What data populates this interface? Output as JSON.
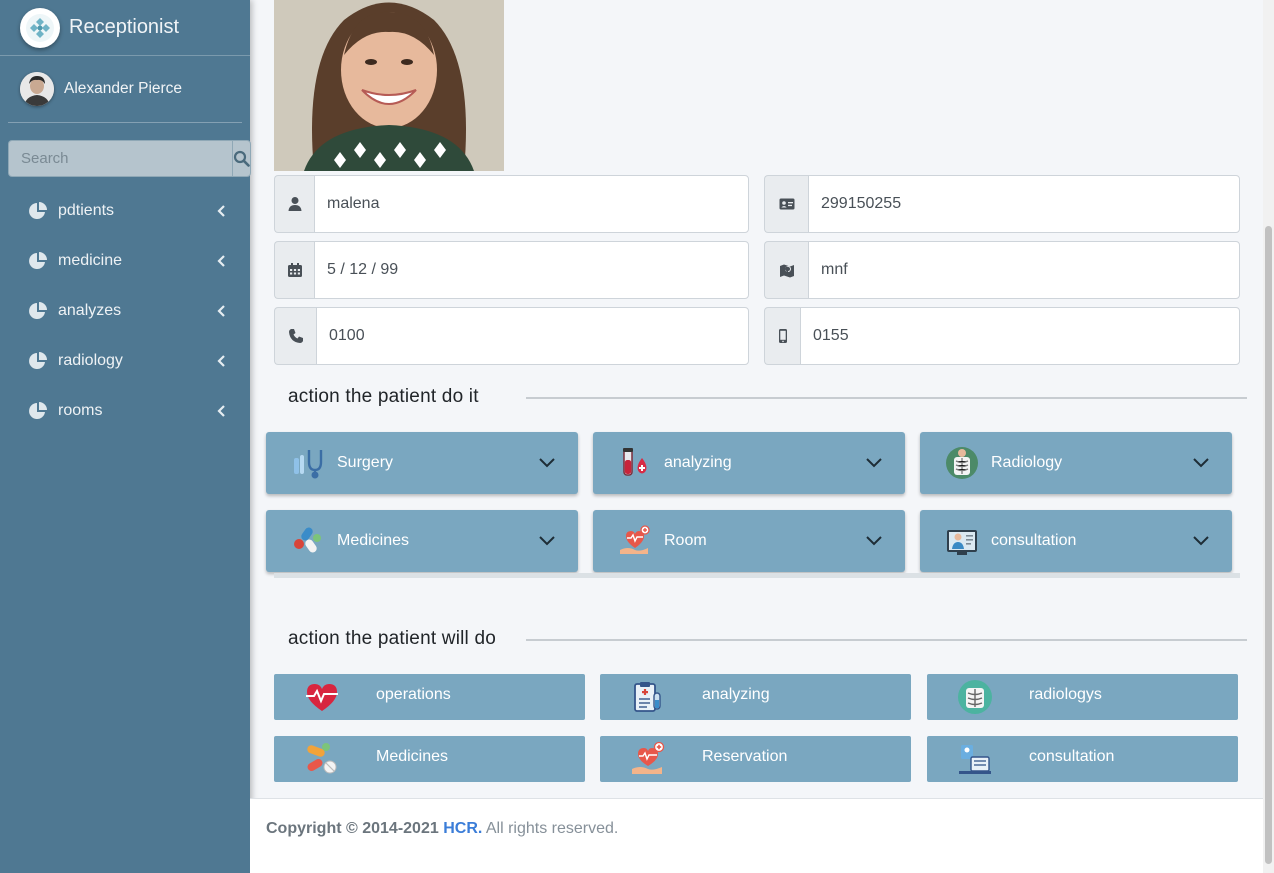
{
  "app": {
    "title": "Receptionist"
  },
  "user": {
    "name": "Alexander Pierce"
  },
  "search": {
    "placeholder": "Search"
  },
  "nav": [
    {
      "label": "pdtients"
    },
    {
      "label": "medicine"
    },
    {
      "label": "analyzes"
    },
    {
      "label": "radiology"
    },
    {
      "label": "rooms"
    }
  ],
  "patient": {
    "name": "malena",
    "id_number": "299150255",
    "birth_date": "5 / 12 / 99",
    "address": "mnf",
    "phone": "0100",
    "mobile": "0155"
  },
  "sections": {
    "done": "action the patient do it",
    "planned": "action the patient will do"
  },
  "done_actions": [
    {
      "label": "Surgery",
      "icon": "stethoscope-icon"
    },
    {
      "label": "analyzing",
      "icon": "blood-test-icon"
    },
    {
      "label": "Radiology",
      "icon": "xray-icon"
    },
    {
      "label": "Medicines",
      "icon": "pills-icon"
    },
    {
      "label": "Room",
      "icon": "heart-hand-icon"
    },
    {
      "label": "consultation",
      "icon": "doctor-icon"
    }
  ],
  "planned_actions": [
    {
      "label": "operations",
      "icon": "heartbeat-icon"
    },
    {
      "label": "analyzing",
      "icon": "clipboard-icon"
    },
    {
      "label": "radiologys",
      "icon": "xray-icon"
    },
    {
      "label": "Medicines",
      "icon": "pills-icon"
    },
    {
      "label": "Reservation",
      "icon": "heart-hand-icon"
    },
    {
      "label": "consultation",
      "icon": "doctor-desk-icon"
    }
  ],
  "footer": {
    "copyright": "Copyright © 2014-2021",
    "brand": "HCR.",
    "rights": "All rights reserved."
  },
  "colors": {
    "sidebar": "#4f7892",
    "action_button": "#7aa7c0",
    "link": "#3b7dd8"
  }
}
